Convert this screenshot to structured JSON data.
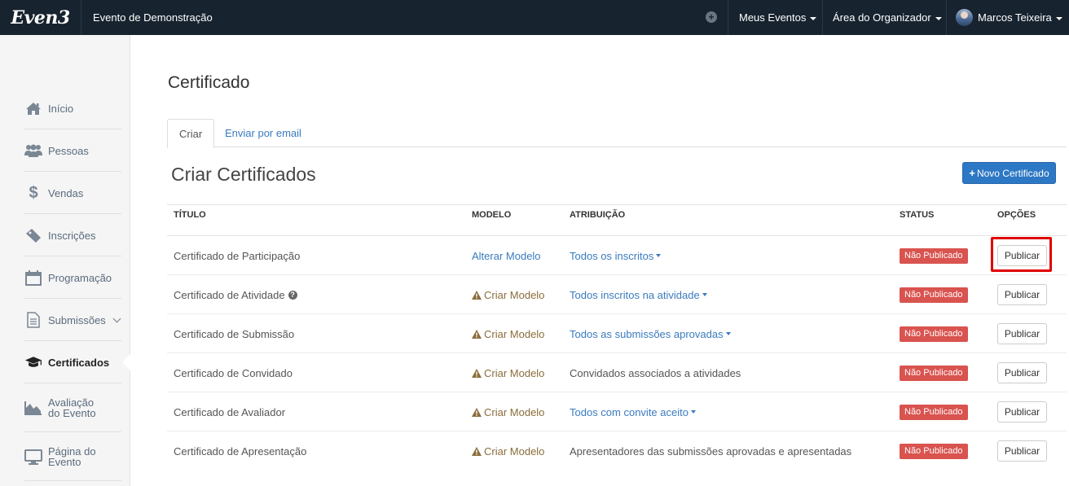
{
  "topnav": {
    "logo": "Even3",
    "event_name": "Evento de Demonstração",
    "add_icon": "plus-circle-icon",
    "meus_eventos": "Meus Eventos",
    "area_organizador": "Área do Organizador",
    "user_name": "Marcos Teixeira"
  },
  "sidebar": {
    "items": [
      {
        "label": "Início",
        "icon": "home-icon"
      },
      {
        "label": "Pessoas",
        "icon": "users-icon"
      },
      {
        "label": "Vendas",
        "icon": "dollar-icon"
      },
      {
        "label": "Inscrições",
        "icon": "ticket-icon"
      },
      {
        "label": "Programação",
        "icon": "calendar-icon"
      },
      {
        "label": "Submissões",
        "icon": "document-icon"
      },
      {
        "label": "Certificados",
        "icon": "graduation-cap-icon"
      },
      {
        "label": "Avaliação do Evento",
        "label_line1": "Avaliação",
        "label_line2": "do Evento",
        "icon": "area-chart-icon"
      },
      {
        "label": "Página do Evento",
        "label_line1": "Página do",
        "label_line2": "Evento",
        "icon": "monitor-icon"
      }
    ],
    "active_item": "Certificados"
  },
  "main": {
    "page_title": "Certificado",
    "tabs": [
      {
        "label": "Criar"
      },
      {
        "label": "Enviar por email"
      }
    ],
    "section_title": "Criar Certificados",
    "new_button_label": "Novo Certificado",
    "table": {
      "headers": [
        "TÍTULO",
        "MODELO",
        "ATRIBUIÇÃO",
        "STATUS",
        "OPÇÕES"
      ],
      "rows": [
        {
          "title": "Certificado de Participação",
          "model": "Alterar Modelo",
          "attribution": "Todos os inscritos",
          "status": "Não Publicado",
          "action": "Publicar"
        },
        {
          "title": "Certificado de Atividade",
          "model": "Criar Modelo",
          "attribution": "Todos inscritos na atividade",
          "status": "Não Publicado",
          "action": "Publicar"
        },
        {
          "title": "Certificado de Submissão",
          "model": "Criar Modelo",
          "attribution": "Todos as submissões aprovadas",
          "status": "Não Publicado",
          "action": "Publicar"
        },
        {
          "title": "Certificado de Convidado",
          "model": "Criar Modelo",
          "attribution": "Convidados associados a atividades",
          "status": "Não Publicado",
          "action": "Publicar"
        },
        {
          "title": "Certificado de Avaliador",
          "model": "Criar Modelo",
          "attribution": "Todos com convite aceito",
          "status": "Não Publicado",
          "action": "Publicar"
        },
        {
          "title": "Certificado de Apresentação",
          "model": "Criar Modelo",
          "attribution": "Apresentadores das submissões aprovadas e apresentadas",
          "status": "Não Publicado",
          "action": "Publicar"
        }
      ]
    }
  },
  "colors": {
    "topnav_bg": "#17232f",
    "link": "#3a7bbf",
    "primary_button": "#2d78c4",
    "status_badge": "#d9534f",
    "warning": "#8a6d3b",
    "highlight_border": "#e00000"
  }
}
